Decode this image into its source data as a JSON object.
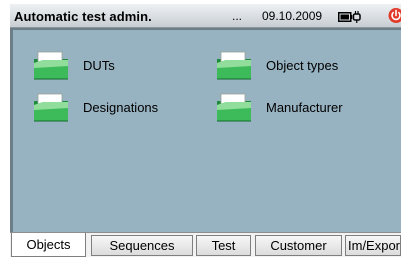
{
  "titlebar": {
    "title": "Automatic test admin.",
    "ellipsis": "...",
    "date": "09.10.2009",
    "battery_icon": "battery-plug-icon",
    "power_icon": "power-icon",
    "power_color": "#e23a2a"
  },
  "main": {
    "background": "#97b2c0",
    "items": [
      {
        "label": "DUTs",
        "icon": "folder-icon"
      },
      {
        "label": "Object types",
        "icon": "folder-icon"
      },
      {
        "label": "Designations",
        "icon": "folder-icon"
      },
      {
        "label": "Manufacturer",
        "icon": "folder-icon"
      }
    ]
  },
  "tabs": [
    {
      "label": "Objects",
      "active": true
    },
    {
      "label": "Sequences",
      "active": false
    },
    {
      "label": "Test",
      "active": false
    },
    {
      "label": "Customer",
      "active": false
    },
    {
      "label": "Im/Export",
      "active": false
    }
  ]
}
